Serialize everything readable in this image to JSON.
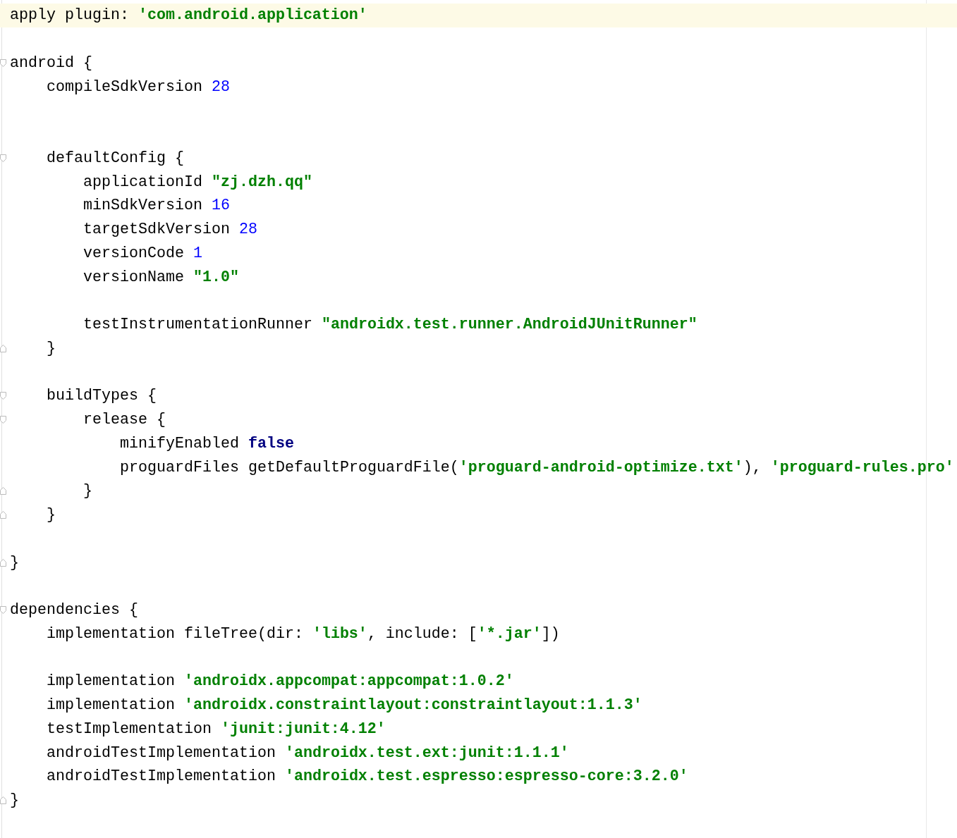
{
  "lines": [
    {
      "current": true,
      "fold_start": false,
      "fold_end": false,
      "tokens": [
        {
          "kind": "plain",
          "text": "apply plugin: "
        },
        {
          "kind": "string",
          "text": "'com.android.application'"
        }
      ]
    },
    {
      "current": false,
      "fold_start": false,
      "fold_end": false
    },
    {
      "current": false,
      "fold_start": true,
      "fold_end": false,
      "tokens": [
        {
          "kind": "plain",
          "text": "android {"
        }
      ],
      "children": [
        {
          "current": false,
          "fold_start": false,
          "fold_end": false,
          "tokens": [
            {
              "kind": "plain",
              "text": "compileSdkVersion "
            },
            {
              "kind": "number",
              "text": "28"
            }
          ]
        },
        {
          "current": false,
          "fold_start": false,
          "fold_end": false
        },
        {
          "current": false,
          "fold_start": false,
          "fold_end": false
        },
        {
          "current": false,
          "fold_start": true,
          "fold_end": false,
          "tokens": [
            {
              "kind": "plain",
              "text": "defaultConfig {"
            }
          ],
          "children": [
            {
              "current": false,
              "fold_start": false,
              "fold_end": false,
              "tokens": [
                {
                  "kind": "plain",
                  "text": "applicationId "
                },
                {
                  "kind": "string",
                  "text": "\"zj.dzh.qq\""
                }
              ]
            },
            {
              "current": false,
              "fold_start": false,
              "fold_end": false,
              "tokens": [
                {
                  "kind": "plain",
                  "text": "minSdkVersion "
                },
                {
                  "kind": "number",
                  "text": "16"
                }
              ]
            },
            {
              "current": false,
              "fold_start": false,
              "fold_end": false,
              "tokens": [
                {
                  "kind": "plain",
                  "text": "targetSdkVersion "
                },
                {
                  "kind": "number",
                  "text": "28"
                }
              ]
            },
            {
              "current": false,
              "fold_start": false,
              "fold_end": false,
              "tokens": [
                {
                  "kind": "plain",
                  "text": "versionCode "
                },
                {
                  "kind": "number",
                  "text": "1"
                }
              ]
            },
            {
              "current": false,
              "fold_start": false,
              "fold_end": false,
              "tokens": [
                {
                  "kind": "plain",
                  "text": "versionName "
                },
                {
                  "kind": "string",
                  "text": "\"1.0\""
                }
              ]
            },
            {
              "current": false,
              "fold_start": false,
              "fold_end": false
            },
            {
              "current": false,
              "fold_start": false,
              "fold_end": false,
              "tokens": [
                {
                  "kind": "plain",
                  "text": "testInstrumentationRunner "
                },
                {
                  "kind": "string",
                  "text": "\"androidx.test.runner.AndroidJUnitRunner\""
                }
              ]
            }
          ]
        },
        {
          "current": false,
          "fold_start": false,
          "fold_end": true,
          "tokens": [
            {
              "kind": "plain",
              "text": "}"
            }
          ]
        },
        {
          "current": false,
          "fold_start": false,
          "fold_end": false
        },
        {
          "current": false,
          "fold_start": true,
          "fold_end": false,
          "tokens": [
            {
              "kind": "plain",
              "text": "buildTypes {"
            }
          ],
          "children": [
            {
              "current": false,
              "fold_start": true,
              "fold_end": false,
              "tokens": [
                {
                  "kind": "plain",
                  "text": "release {"
                }
              ],
              "children": [
                {
                  "current": false,
                  "fold_start": false,
                  "fold_end": false,
                  "tokens": [
                    {
                      "kind": "plain",
                      "text": "minifyEnabled "
                    },
                    {
                      "kind": "keyword",
                      "text": "false"
                    }
                  ]
                },
                {
                  "current": false,
                  "fold_start": false,
                  "fold_end": false,
                  "tokens": [
                    {
                      "kind": "plain",
                      "text": "proguardFiles getDefaultProguardFile("
                    },
                    {
                      "kind": "string",
                      "text": "'proguard-android-optimize.txt'"
                    },
                    {
                      "kind": "plain",
                      "text": "), "
                    },
                    {
                      "kind": "string",
                      "text": "'proguard-rules.pro'"
                    }
                  ]
                }
              ]
            },
            {
              "current": false,
              "fold_start": false,
              "fold_end": true,
              "tokens": [
                {
                  "kind": "plain",
                  "text": "}"
                }
              ]
            }
          ]
        },
        {
          "current": false,
          "fold_start": false,
          "fold_end": true,
          "tokens": [
            {
              "kind": "plain",
              "text": "}"
            }
          ]
        },
        {
          "current": false,
          "fold_start": false,
          "fold_end": false
        }
      ]
    },
    {
      "current": false,
      "fold_start": false,
      "fold_end": true,
      "tokens": [
        {
          "kind": "plain",
          "text": "}"
        }
      ]
    },
    {
      "current": false,
      "fold_start": false,
      "fold_end": false
    },
    {
      "current": false,
      "fold_start": true,
      "fold_end": false,
      "tokens": [
        {
          "kind": "plain",
          "text": "dependencies {"
        }
      ],
      "children": [
        {
          "current": false,
          "fold_start": false,
          "fold_end": false,
          "tokens": [
            {
              "kind": "plain",
              "text": "implementation fileTree(dir: "
            },
            {
              "kind": "string",
              "text": "'libs'"
            },
            {
              "kind": "plain",
              "text": ", include: ["
            },
            {
              "kind": "string",
              "text": "'*.jar'"
            },
            {
              "kind": "plain",
              "text": "])"
            }
          ]
        },
        {
          "current": false,
          "fold_start": false,
          "fold_end": false
        },
        {
          "current": false,
          "fold_start": false,
          "fold_end": false,
          "tokens": [
            {
              "kind": "plain",
              "text": "implementation "
            },
            {
              "kind": "string",
              "text": "'androidx.appcompat:appcompat:1.0.2'"
            }
          ]
        },
        {
          "current": false,
          "fold_start": false,
          "fold_end": false,
          "tokens": [
            {
              "kind": "plain",
              "text": "implementation "
            },
            {
              "kind": "string",
              "text": "'androidx.constraintlayout:constraintlayout:1.1.3'"
            }
          ]
        },
        {
          "current": false,
          "fold_start": false,
          "fold_end": false,
          "tokens": [
            {
              "kind": "plain",
              "text": "testImplementation "
            },
            {
              "kind": "string",
              "text": "'junit:junit:4.12'"
            }
          ]
        },
        {
          "current": false,
          "fold_start": false,
          "fold_end": false,
          "tokens": [
            {
              "kind": "plain",
              "text": "androidTestImplementation "
            },
            {
              "kind": "string",
              "text": "'androidx.test.ext:junit:1.1.1'"
            }
          ]
        },
        {
          "current": false,
          "fold_start": false,
          "fold_end": false,
          "tokens": [
            {
              "kind": "plain",
              "text": "androidTestImplementation "
            },
            {
              "kind": "string",
              "text": "'androidx.test.espresso:espresso-core:3.2.0'"
            }
          ]
        }
      ]
    },
    {
      "current": false,
      "fold_start": false,
      "fold_end": true,
      "tokens": [
        {
          "kind": "plain",
          "text": "}"
        }
      ]
    }
  ]
}
